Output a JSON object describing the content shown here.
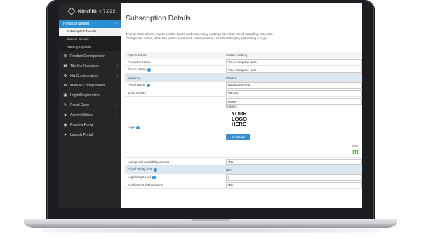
{
  "brand": {
    "name": "KONFIG",
    "version": "v 7.622"
  },
  "sidebar": {
    "section": {
      "label": "Portal Branding",
      "chevron": "⌄"
    },
    "sub_items": [
      {
        "label": "Subscription Details",
        "active": true
      },
      {
        "label": "Banner Details",
        "active": false
      },
      {
        "label": "Naming Options",
        "active": false
      }
    ],
    "items": [
      {
        "label": "Product Configuration",
        "icon": "gear-icon",
        "glyph": "⚙",
        "chevron": ""
      },
      {
        "label": "Tile Configuration",
        "icon": "tiles-icon",
        "glyph": "▦",
        "chevron": "›"
      },
      {
        "label": "HA Configuration",
        "icon": "gear-icon",
        "glyph": "⚙",
        "chevron": "›"
      },
      {
        "label": "Module Configuration",
        "icon": "gear-icon",
        "glyph": "⚙",
        "chevron": ""
      },
      {
        "label": "Login/Registration",
        "icon": "login-icon",
        "glyph": "▣",
        "chevron": ""
      },
      {
        "label": "Portal Copy",
        "icon": "pencil-icon",
        "glyph": "✎",
        "chevron": "›"
      },
      {
        "label": "Admin Utilities",
        "icon": "users-icon",
        "glyph": "☻",
        "chevron": "›"
      },
      {
        "label": "Preview Portal",
        "icon": "eye-icon",
        "glyph": "◉",
        "chevron": ""
      },
      {
        "label": "Launch Portal",
        "icon": "send-icon",
        "glyph": "➤",
        "chevron": ""
      }
    ]
  },
  "main": {
    "title": "Subscription Details",
    "description": "This section allows you to set the basic and necessary settings for initial portal branding. You can change the name, what the portal is named, color scheme, and branding by uploading a logo.",
    "table": {
      "headers": [
        "Option Name",
        "Current Setting"
      ],
      "rows": [
        {
          "label": "Company Name",
          "value": "Your Company Here",
          "type": "input",
          "info": false,
          "hl": false
        },
        {
          "label": "Group Name",
          "value": "Your Company Here",
          "type": "input",
          "info": true,
          "hl": false
        },
        {
          "label": "Group ID",
          "value": "MIG1A",
          "type": "text",
          "info": false,
          "hl": true
        },
        {
          "label": "Portal Name",
          "value": "Wellness Portal",
          "type": "input",
          "info": true,
          "hl": false
        },
        {
          "label": "Color Palette",
          "value": "*Green",
          "type": "input",
          "info": false,
          "hl": false
        }
      ],
      "logo_row": {
        "label": "Logo",
        "info": true,
        "select_value": "Other",
        "current_label": "Current:",
        "logo_text": [
          "YOUR",
          "LOGO",
          "HERE"
        ],
        "upload_label": "⬆ Upload",
        "default_label": "Defa",
        "default_mark": "m"
      },
      "rows_after": [
        {
          "label": "Limit portal availability access",
          "value": "*No",
          "type": "input",
          "info": false,
          "hl": false
        },
        {
          "label": "Portal Vanity URL",
          "value": "N/A",
          "type": "text",
          "info": true,
          "hl": true
        },
        {
          "label": "Login/Logout Url",
          "value": "/",
          "type": "input",
          "info": true,
          "hl": false
        },
        {
          "label": "Enable Portal Translation",
          "value": "*No",
          "type": "input",
          "info": false,
          "hl": false
        }
      ]
    }
  },
  "colors": {
    "accent": "#2a8ed0",
    "sidebar_bg": "#262626",
    "highlight_row": "#dbe8f2"
  }
}
